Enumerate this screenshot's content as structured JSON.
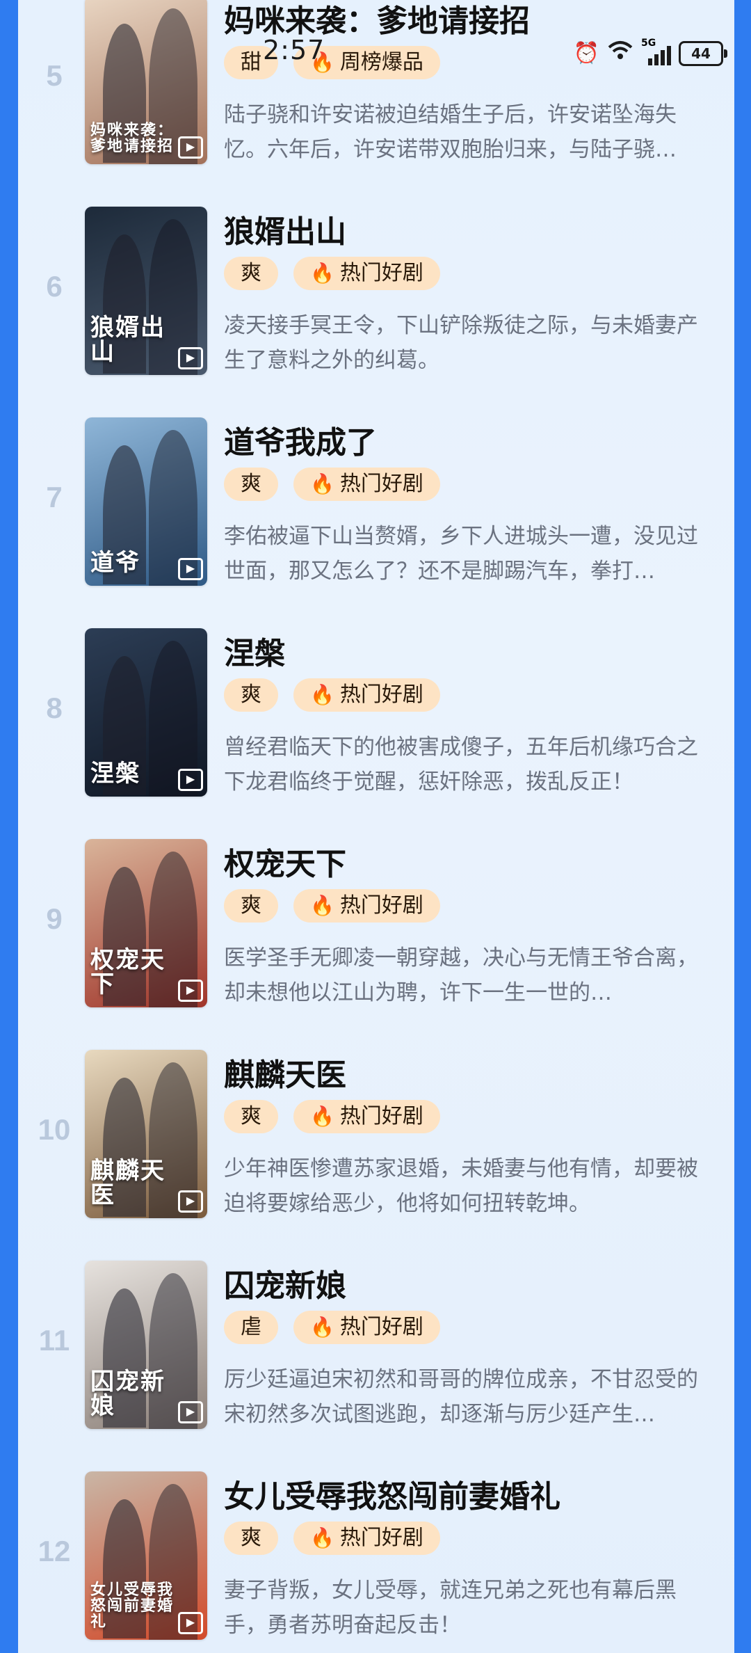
{
  "status": {
    "time": "2:57",
    "network": "5G",
    "battery": "44"
  },
  "items": [
    {
      "rank": "5",
      "title": "妈咪来袭：爹地请接招",
      "genre": "甜",
      "badge": "周榜爆品",
      "poster_text": "妈咪来袭：爹地请接招",
      "desc": "陆子骁和许安诺被迫结婚生子后，许安诺坠海失忆。六年后，许安诺带双胞胎归来，与陆子骁…",
      "colors": [
        "#e9d6c3",
        "#a2715a"
      ]
    },
    {
      "rank": "6",
      "title": "狼婿出山",
      "genre": "爽",
      "badge": "热门好剧",
      "poster_text": "狼婿出山",
      "desc": "凌天接手冥王令，下山铲除叛徒之际，与未婚妻产生了意料之外的纠葛。",
      "colors": [
        "#1d2a3a",
        "#4a5a6e"
      ]
    },
    {
      "rank": "7",
      "title": "道爷我成了",
      "genre": "爽",
      "badge": "热门好剧",
      "poster_text": "道爷",
      "desc": "李佑被逼下山当赘婿，乡下人进城头一遭，没见过世面，那又怎么了？还不是脚踢汽车，拳打…",
      "colors": [
        "#8fb6d8",
        "#2f5a86"
      ]
    },
    {
      "rank": "8",
      "title": "涅槃",
      "genre": "爽",
      "badge": "热门好剧",
      "poster_text": "涅槃",
      "desc": "曾经君临天下的他被害成傻子，五年后机缘巧合之下龙君临终于觉醒，惩奸除恶，拨乱反正！",
      "colors": [
        "#2c3d55",
        "#0f1724"
      ]
    },
    {
      "rank": "9",
      "title": "权宠天下",
      "genre": "爽",
      "badge": "热门好剧",
      "poster_text": "权宠天下",
      "desc": "医学圣手无卿凌一朝穿越，决心与无情王爷合离，却未想他以江山为聘，许下一生一世的…",
      "colors": [
        "#d9b49a",
        "#a0352a"
      ]
    },
    {
      "rank": "10",
      "title": "麒麟天医",
      "genre": "爽",
      "badge": "热门好剧",
      "poster_text": "麒麟天医",
      "desc": "少年神医惨遭苏家退婚，未婚妻与他有情，却要被迫将要嫁给恶少，他将如何扭转乾坤。",
      "colors": [
        "#e8d9bf",
        "#7a5a3c"
      ]
    },
    {
      "rank": "11",
      "title": "囚宠新娘",
      "genre": "虐",
      "badge": "热门好剧",
      "poster_text": "囚宠新娘",
      "desc": "厉少廷逼迫宋初然和哥哥的牌位成亲，不甘忍受的宋初然多次试图逃跑，却逐渐与厉少廷产生…",
      "colors": [
        "#e6e2de",
        "#8b7f78"
      ]
    },
    {
      "rank": "12",
      "title": "女儿受辱我怒闯前妻婚礼",
      "genre": "爽",
      "badge": "热门好剧",
      "poster_text": "女儿受辱我怒闯前妻婚礼",
      "desc": "妻子背叛，女儿受辱，就连兄弟之死也有幕后黑手，勇者苏明奋起反击！",
      "colors": [
        "#c9b6a6",
        "#d24a2a"
      ]
    }
  ]
}
